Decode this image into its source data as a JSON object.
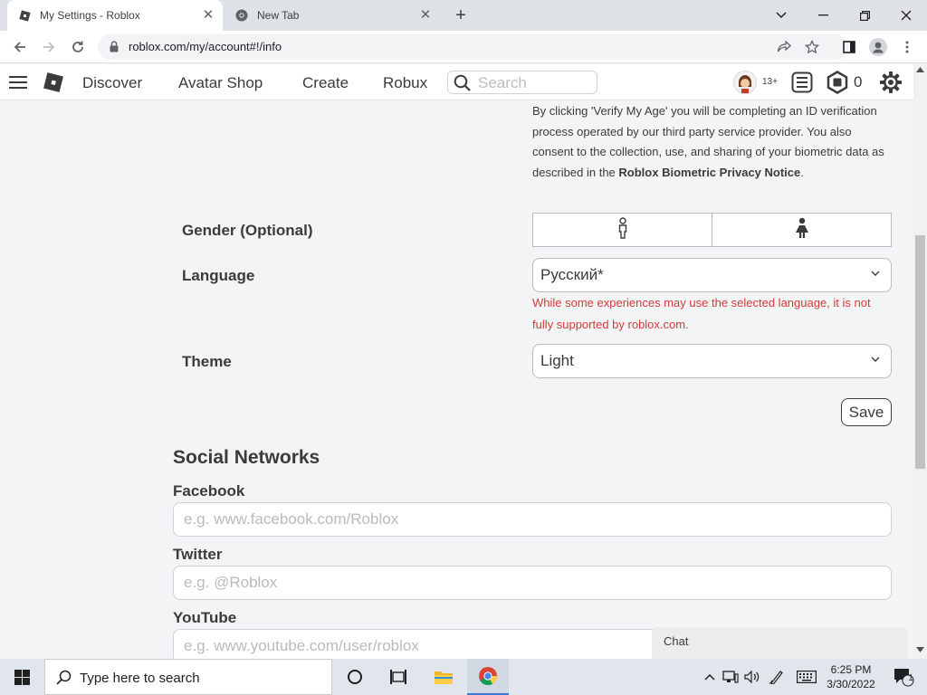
{
  "browser": {
    "tabs": [
      {
        "title": "My Settings - Roblox"
      },
      {
        "title": "New Tab"
      }
    ],
    "url": "roblox.com/my/account#!/info"
  },
  "roblox_header": {
    "nav": [
      "Discover",
      "Avatar Shop",
      "Create",
      "Robux"
    ],
    "search_placeholder": "Search",
    "age_badge": "13+",
    "robux_count": "0"
  },
  "verify_notice": {
    "text": "By clicking 'Verify My Age' you will be completing an ID verification process operated by our third party service provider. You also consent to the collection, use, and sharing of your biometric data as described in the",
    "link": "Roblox Biometric Privacy Notice",
    "end": "."
  },
  "gender": {
    "label": "Gender (Optional)"
  },
  "language": {
    "label": "Language",
    "selected": "Русский*",
    "warning": "While some experiences may use the selected language, it is not fully supported by roblox.com."
  },
  "theme": {
    "label": "Theme",
    "selected": "Light"
  },
  "save_label": "Save",
  "social": {
    "title": "Social Networks",
    "facebook": {
      "label": "Facebook",
      "placeholder": "e.g. www.facebook.com/Roblox"
    },
    "twitter": {
      "label": "Twitter",
      "placeholder": "e.g. @Roblox"
    },
    "youtube": {
      "label": "YouTube",
      "placeholder": "e.g. www.youtube.com/user/roblox"
    }
  },
  "chat_label": "Chat",
  "taskbar": {
    "search_placeholder": "Type here to search",
    "time": "6:25 PM",
    "date": "3/30/2022",
    "notification_count": "1"
  },
  "colors": {
    "warning": "#d63a3a",
    "chrome_tab_strip": "#dee1e6",
    "taskbar": "#e1e6ec"
  }
}
